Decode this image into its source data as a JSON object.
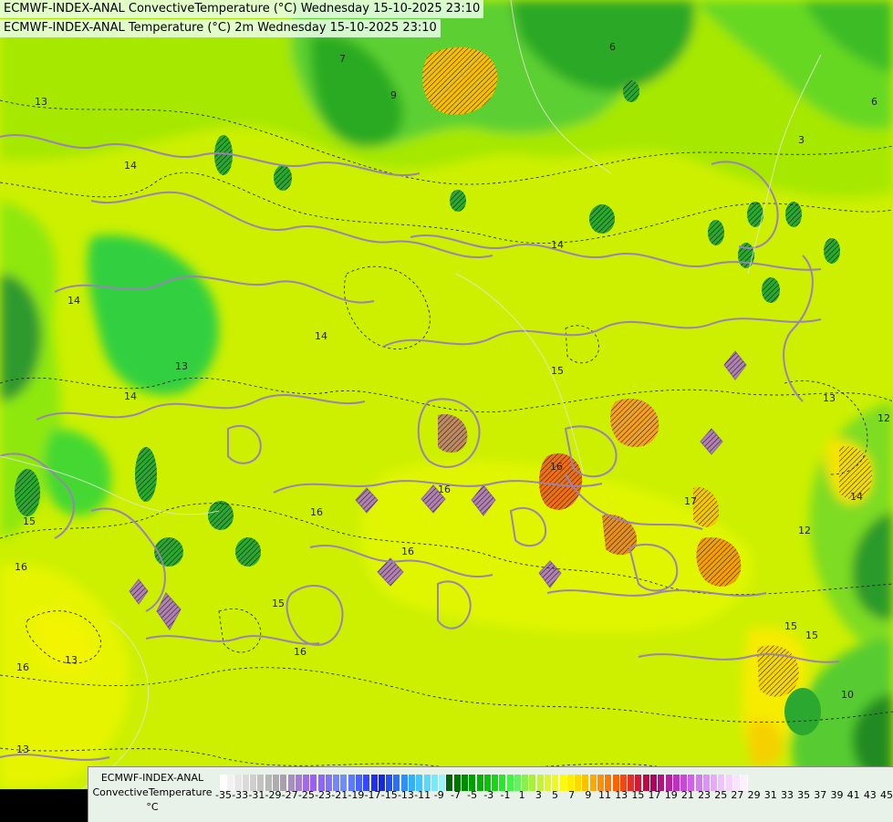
{
  "titles": {
    "line1": "ECMWF-INDEX-ANAL ConvectiveTemperature (°C) Wednesday 15-10-2025 23:10",
    "line2": "ECMWF-INDEX-ANAL Temperature (°C) 2m Wednesday 15-10-2025 23:10"
  },
  "legend": {
    "line1": "ECMWF-INDEX-ANAL",
    "line2": "ConvectiveTemperature",
    "unit": "°C",
    "ticks": [
      "-35",
      "-33",
      "-31",
      "-29",
      "-27",
      "-25",
      "-23",
      "-21",
      "-19",
      "-17",
      "-15",
      "-13",
      "-11",
      "-9",
      "-7",
      "-5",
      "-3",
      "-1",
      "1",
      "3",
      "5",
      "7",
      "9",
      "11",
      "13",
      "15",
      "17",
      "19",
      "21",
      "23",
      "25",
      "27",
      "29",
      "31",
      "33",
      "35",
      "37",
      "39",
      "41",
      "43",
      "45"
    ],
    "colors": [
      "#ffffff",
      "#f2f2f2",
      "#e6e6e6",
      "#dadada",
      "#cfcfcf",
      "#c3c3c3",
      "#b8b8b8",
      "#adadad",
      "#a8a0b0",
      "#a58fbf",
      "#a47ed0",
      "#a06de0",
      "#9a60f0",
      "#8f65ff",
      "#8273ff",
      "#7585ff",
      "#6b8fff",
      "#5b7aff",
      "#4a63ff",
      "#3348ff",
      "#1f30f5",
      "#1428e0",
      "#1e50ff",
      "#2670ff",
      "#2e90ff",
      "#38acff",
      "#44c4ff",
      "#55dbff",
      "#70ecff",
      "#92f8ff",
      "#006400",
      "#007800",
      "#008c00",
      "#00a000",
      "#00b400",
      "#00c800",
      "#10da10",
      "#24ec24",
      "#44f444",
      "#66f060",
      "#88f04a",
      "#a8f03a",
      "#c4f42a",
      "#dcf81e",
      "#eefc14",
      "#fafa0a",
      "#ffee00",
      "#ffd800",
      "#ffc000",
      "#ffa800",
      "#ff9000",
      "#ff7800",
      "#ff6000",
      "#f04818",
      "#e03028",
      "#d01838",
      "#c00848",
      "#b00060",
      "#b41080",
      "#b820a0",
      "#c030c0",
      "#c848d8",
      "#d060e8",
      "#d878f0",
      "#e090f8",
      "#e8a8fc",
      "#f0c0ff",
      "#f4d4ff",
      "#f8e4ff",
      "#fcf0ff"
    ]
  },
  "map": {
    "contour_labels_temperature": [
      "13",
      "14",
      "14",
      "14",
      "15",
      "15",
      "16",
      "16",
      "16",
      "17",
      "13",
      "14",
      "14",
      "15",
      "16",
      "16",
      "16",
      "15",
      "13",
      "12",
      "14",
      "12",
      "15",
      "16",
      "10",
      "13",
      "3",
      "6",
      "6",
      "7",
      "9",
      "13"
    ],
    "colors": {
      "base": "#ccf000",
      "green_light": "#88e000",
      "green": "#44cc10",
      "green_dark": "#1a9a1a",
      "yellow": "#eaf400",
      "yellow_warm": "#f6e800",
      "orange": "#f4a000",
      "contour_solid": "#9a82b6",
      "contour_dashed": "#1a1a1a",
      "coast": "#d8d8c8"
    }
  }
}
